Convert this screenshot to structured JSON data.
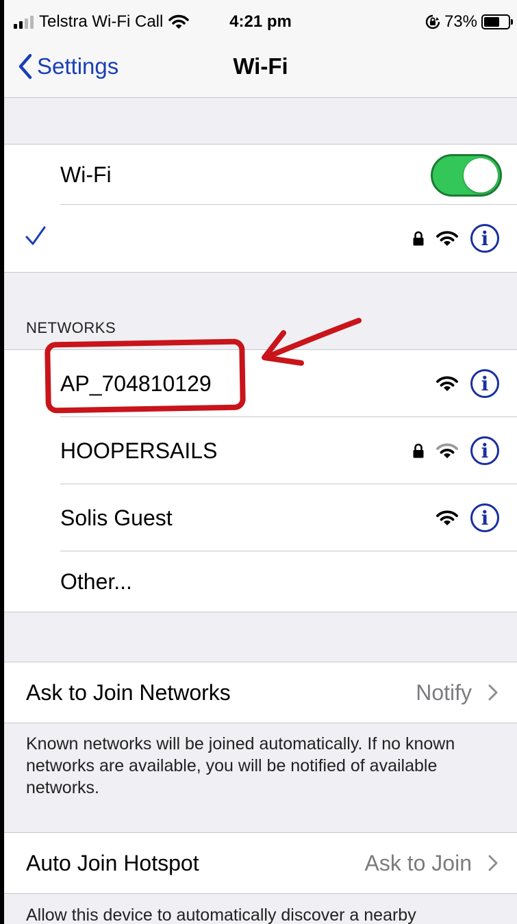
{
  "status_bar": {
    "carrier": "Telstra Wi-Fi Call",
    "time": "4:21 pm",
    "battery_percent": "73%",
    "battery_level": 0.73,
    "signal_bars_active": 2
  },
  "nav": {
    "back_label": "Settings",
    "title": "Wi-Fi"
  },
  "wifi_toggle": {
    "label": "Wi-Fi",
    "on": true
  },
  "connected_network": {
    "name": "",
    "secured": true,
    "info_label": "i"
  },
  "networks_section": {
    "header": "NETWORKS",
    "items": [
      {
        "name": "AP_704810129",
        "secured": false,
        "info_label": "i"
      },
      {
        "name": "HOOPERSAILS",
        "secured": true,
        "info_label": "i"
      },
      {
        "name": "Solis Guest",
        "secured": false,
        "info_label": "i"
      },
      {
        "name": "Other..."
      }
    ]
  },
  "ask_to_join": {
    "label": "Ask to Join Networks",
    "value": "Notify",
    "footnote": "Known networks will be joined automatically. If no known networks are available, you will be notified of available networks."
  },
  "auto_join_hotspot": {
    "label": "Auto Join Hotspot",
    "value": "Ask to Join",
    "footnote": "Allow this device to automatically discover a nearby"
  },
  "colors": {
    "accent_blue": "#1a3fb5",
    "toggle_green": "#33c759",
    "annotation_red": "#c8141a",
    "background": "#efeff4"
  },
  "icons": [
    "signal-bars-icon",
    "wifi-icon",
    "orientation-lock-icon",
    "battery-icon",
    "chevron-left-icon",
    "checkmark-icon",
    "lock-icon",
    "info-icon",
    "chevron-right-icon"
  ]
}
